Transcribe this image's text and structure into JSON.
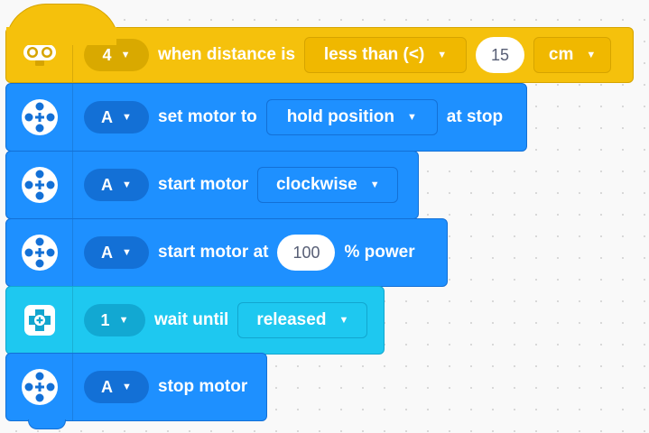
{
  "blocks": {
    "hat": {
      "icon": "distance-sensor-icon",
      "port": "4",
      "label": "when distance is",
      "comparator": "less than (<)",
      "value": "15",
      "unit": "cm",
      "color": "#f5c10c"
    },
    "set_stop": {
      "icon": "motor-icon",
      "port": "A",
      "label": "set motor to",
      "option": "hold position",
      "suffix": "at stop",
      "color": "#1e90ff"
    },
    "start_dir": {
      "icon": "motor-icon",
      "port": "A",
      "label": "start motor",
      "direction": "clockwise"
    },
    "start_power": {
      "icon": "motor-icon",
      "port": "A",
      "label": "start motor at",
      "value": "100",
      "suffix": "% power"
    },
    "wait": {
      "icon": "force-sensor-icon",
      "port": "1",
      "label": "wait until",
      "option": "released",
      "color": "#1ec8f0"
    },
    "stop": {
      "icon": "motor-icon",
      "port": "A",
      "label": "stop motor"
    }
  },
  "caret": "▼"
}
